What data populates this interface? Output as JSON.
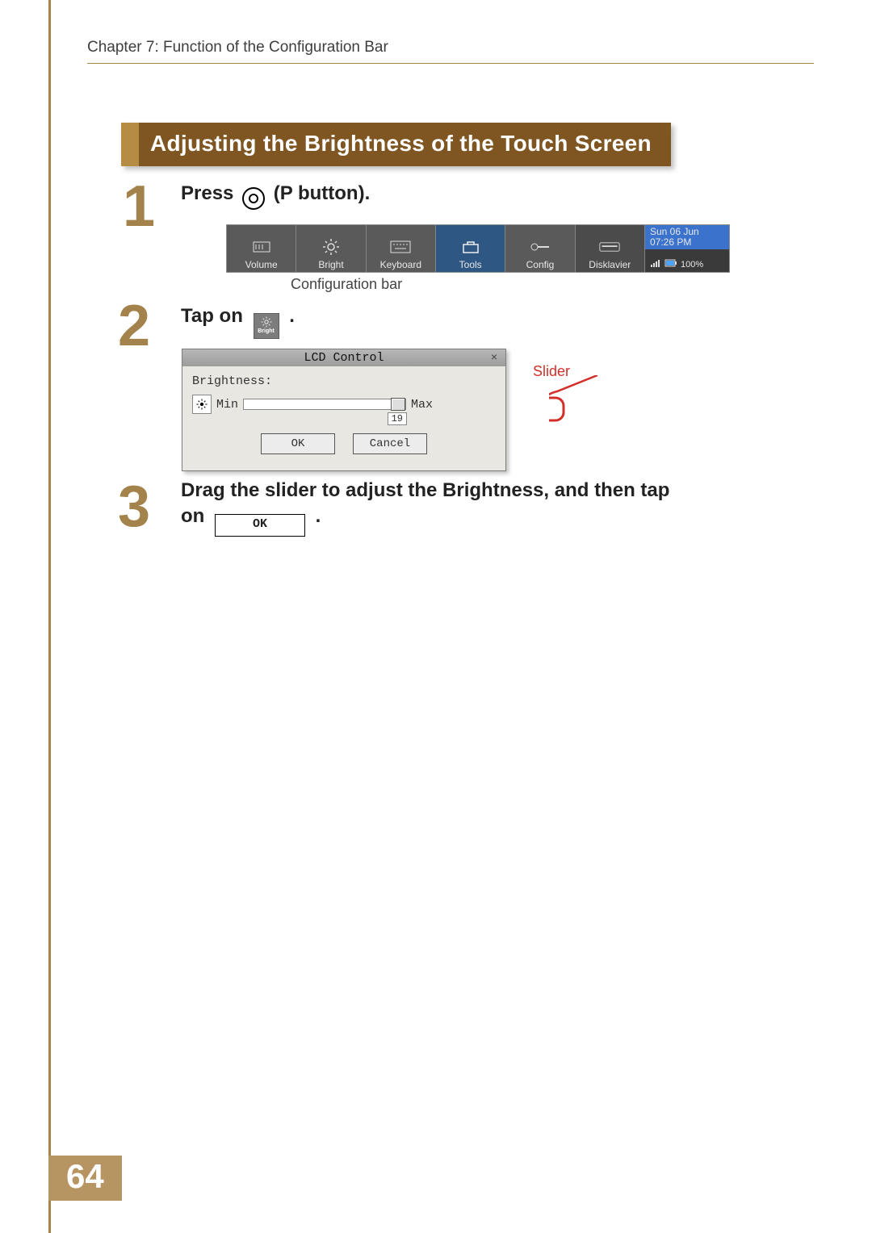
{
  "header": {
    "chapter_line": "Chapter 7: Function of the Configuration Bar"
  },
  "title": "Adjusting the Brightness of the Touch Screen",
  "steps": {
    "s1": {
      "num": "1",
      "text_pre": "Press",
      "text_post": "(P button)."
    },
    "s2": {
      "num": "2",
      "text": "Tap on",
      "dot": "."
    },
    "s3": {
      "num": "3",
      "line1": "Drag the slider to adjust the Brightness, and then tap",
      "line2_pre": "on",
      "line2_post": "."
    }
  },
  "config_bar": {
    "caption": "Configuration bar",
    "items": [
      {
        "label": "Volume",
        "icon": "volume"
      },
      {
        "label": "Bright",
        "icon": "sun"
      },
      {
        "label": "Keyboard",
        "icon": "keyboard"
      },
      {
        "label": "Tools",
        "icon": "toolbox"
      },
      {
        "label": "Config",
        "icon": "disc"
      },
      {
        "label": "Disklavier",
        "icon": "piano"
      }
    ],
    "status": {
      "date": "Sun 06 Jun",
      "time": "07:26 PM",
      "battery": "100%"
    }
  },
  "bright_chip_label": "Bright",
  "lcd": {
    "title": "LCD Control",
    "brightness_label": "Brightness:",
    "min": "Min",
    "max": "Max",
    "value": "19",
    "ok": "OK",
    "cancel": "Cancel"
  },
  "slider_callout": "Slider",
  "ok_chip": "OK",
  "page_number": "64"
}
